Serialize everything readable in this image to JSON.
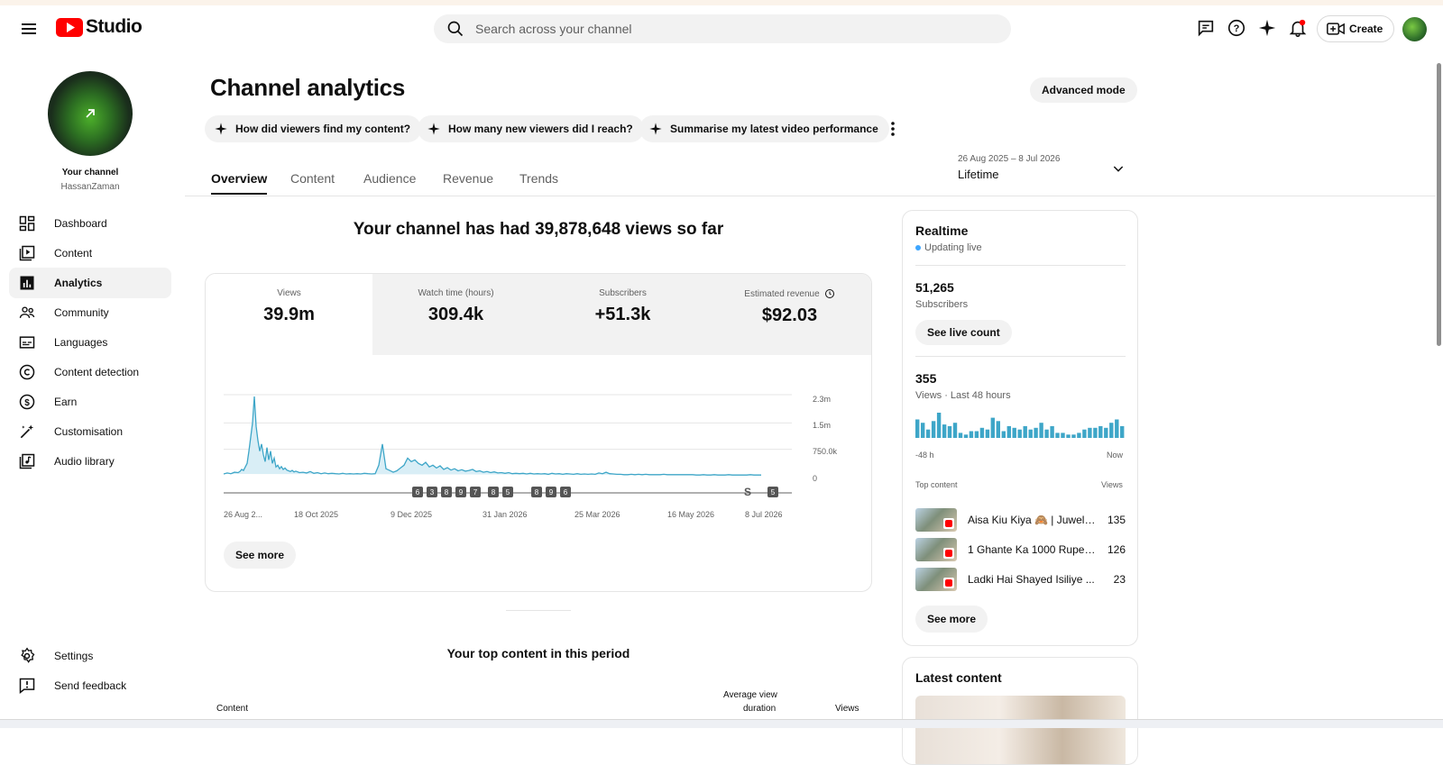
{
  "header": {
    "logo_text": "Studio",
    "search_placeholder": "Search across your channel",
    "create_label": "Create"
  },
  "sidebar": {
    "channel_title": "Your channel",
    "channel_name": "HassanZaman",
    "items": [
      {
        "label": "Dashboard",
        "icon": "dashboard-icon"
      },
      {
        "label": "Content",
        "icon": "content-icon"
      },
      {
        "label": "Analytics",
        "icon": "analytics-icon",
        "active": true
      },
      {
        "label": "Community",
        "icon": "community-icon"
      },
      {
        "label": "Languages",
        "icon": "languages-icon"
      },
      {
        "label": "Content detection",
        "icon": "copyright-icon"
      },
      {
        "label": "Earn",
        "icon": "earn-icon"
      },
      {
        "label": "Customisation",
        "icon": "customisation-icon"
      },
      {
        "label": "Audio library",
        "icon": "audio-library-icon"
      }
    ],
    "bottom_items": [
      {
        "label": "Settings",
        "icon": "settings-icon"
      },
      {
        "label": "Send feedback",
        "icon": "feedback-icon"
      }
    ]
  },
  "main": {
    "title": "Channel analytics",
    "advanced_mode": "Advanced mode",
    "chips": [
      "How did viewers find my content?",
      "How many new viewers did I reach?",
      "Summarise my latest video performance"
    ],
    "tabs": [
      "Overview",
      "Content",
      "Audience",
      "Revenue",
      "Trends"
    ],
    "date_range": "26 Aug 2025 – 8 Jul 2026",
    "date_preset": "Lifetime",
    "views_headline": "Your channel has had 39,878,648 views so far",
    "stats": [
      {
        "label": "Views",
        "value": "39.9m"
      },
      {
        "label": "Watch time (hours)",
        "value": "309.4k"
      },
      {
        "label": "Subscribers",
        "value": "+51.3k"
      },
      {
        "label": "Estimated revenue",
        "value": "$92.03"
      }
    ],
    "see_more": "See more",
    "top_content_title": "Your top content in this period",
    "table_headers": {
      "content": "Content",
      "avg_duration_1": "Average view",
      "avg_duration_2": "duration",
      "views": "Views"
    }
  },
  "chart_data": {
    "type": "area",
    "x_ticks": [
      "26 Aug 2...",
      "18 Oct 2025",
      "9 Dec 2025",
      "31 Jan 2026",
      "25 Mar 2026",
      "16 May 2026",
      "8 Jul 2026"
    ],
    "y_ticks": [
      "2.3m",
      "1.5m",
      "750.0k",
      "0"
    ],
    "ylim": [
      0,
      2300000
    ],
    "color": "#3ea6c8",
    "markers": [
      "6",
      "3",
      "8",
      "9",
      "7",
      "8",
      "5",
      "8",
      "9",
      "6",
      "S",
      "5"
    ],
    "x": [
      0,
      4,
      8,
      12,
      16,
      18,
      20,
      22,
      24,
      26,
      28,
      30,
      32,
      34,
      36,
      38,
      40,
      42,
      44,
      46,
      48,
      50,
      52,
      54,
      56,
      58,
      60,
      62,
      64,
      66,
      68,
      70,
      72,
      74,
      76,
      78,
      80,
      84,
      88,
      92,
      96,
      100,
      104,
      108,
      112,
      116,
      120,
      124,
      128,
      132,
      136,
      140,
      144,
      148,
      152,
      156,
      160,
      164,
      168,
      172,
      176,
      180,
      184,
      188,
      192,
      196,
      200,
      204,
      208,
      212,
      216,
      220,
      224,
      228,
      232,
      236,
      240,
      244,
      248,
      252,
      256,
      260,
      264,
      268,
      272,
      276,
      280,
      284,
      288,
      292,
      296,
      300,
      304,
      308,
      312,
      316,
      320,
      324,
      328,
      332,
      336,
      340,
      344,
      348,
      352,
      356,
      360,
      364,
      368,
      372,
      376,
      380,
      384,
      388,
      392,
      396,
      400,
      404,
      408,
      412,
      416,
      420,
      424,
      428,
      432,
      436,
      440,
      444,
      448,
      452,
      456,
      460,
      464,
      468,
      472,
      476,
      480,
      484,
      488,
      492,
      496,
      500,
      504,
      508,
      512,
      516,
      520,
      524,
      528,
      532,
      536,
      540,
      544,
      548,
      552,
      556,
      560,
      564,
      568,
      572,
      576,
      580,
      584,
      588,
      592,
      596,
      600,
      604,
      608,
      612,
      616,
      620
    ],
    "values": [
      50000,
      80000,
      60000,
      100000,
      90000,
      120000,
      180000,
      150000,
      250000,
      350000,
      700000,
      1100000,
      1500000,
      2250000,
      1400000,
      1000000,
      700000,
      900000,
      600000,
      400000,
      800000,
      450000,
      700000,
      350000,
      500000,
      250000,
      300000,
      200000,
      260000,
      180000,
      220000,
      160000,
      140000,
      120000,
      150000,
      110000,
      130000,
      90000,
      100000,
      80000,
      120000,
      70000,
      90000,
      60000,
      80000,
      60000,
      70000,
      60000,
      50000,
      70000,
      50000,
      60000,
      50000,
      60000,
      50000,
      70000,
      60000,
      50000,
      60000,
      300000,
      900000,
      200000,
      150000,
      100000,
      140000,
      220000,
      300000,
      500000,
      400000,
      450000,
      350000,
      300000,
      380000,
      250000,
      300000,
      220000,
      280000,
      180000,
      230000,
      160000,
      200000,
      140000,
      170000,
      130000,
      150000,
      180000,
      120000,
      140000,
      100000,
      120000,
      90000,
      110000,
      80000,
      90000,
      70000,
      90000,
      60000,
      70000,
      60000,
      70000,
      50000,
      70000,
      50000,
      60000,
      50000,
      60000,
      40000,
      70000,
      50000,
      60000,
      40000,
      60000,
      50000,
      40000,
      60000,
      40000,
      50000,
      40000,
      50000,
      40000,
      80000,
      60000,
      100000,
      60000,
      50000,
      40000,
      40000,
      30000,
      30000,
      40000,
      30000,
      40000,
      30000,
      40000,
      30000,
      30000,
      30000,
      30000,
      40000,
      30000,
      30000,
      30000,
      30000,
      30000,
      30000,
      30000,
      30000,
      20000,
      20000,
      30000,
      20000,
      20000,
      30000,
      20000,
      20000,
      20000,
      30000,
      20000,
      20000,
      20000,
      20000,
      20000,
      30000,
      20000,
      20000,
      20000
    ]
  },
  "realtime": {
    "title": "Realtime",
    "status": "Updating live",
    "subs_value": "51,265",
    "subs_label": "Subscribers",
    "see_live": "See live count",
    "views_value": "355",
    "views_label": "Views · Last 48 hours",
    "axis_left": "-48 h",
    "axis_right": "Now",
    "top_content_label": "Top content",
    "views_col_label": "Views",
    "bars": [
      22,
      18,
      10,
      20,
      30,
      16,
      14,
      18,
      6,
      4,
      8,
      8,
      12,
      10,
      24,
      20,
      8,
      14,
      12,
      10,
      14,
      10,
      12,
      18,
      10,
      14,
      6,
      6,
      4,
      4,
      6,
      10,
      12,
      12,
      14,
      12,
      18,
      22,
      14
    ],
    "rows": [
      {
        "title": "Aisa Kiu Kiya 🙈 | Juwel ...",
        "views": "135"
      },
      {
        "title": "1 Ghante Ka 1000 Rupee...",
        "views": "126"
      },
      {
        "title": "Ladki Hai Shayed Isiliye ...",
        "views": "23"
      }
    ],
    "see_more": "See more"
  },
  "latest": {
    "title": "Latest content"
  }
}
